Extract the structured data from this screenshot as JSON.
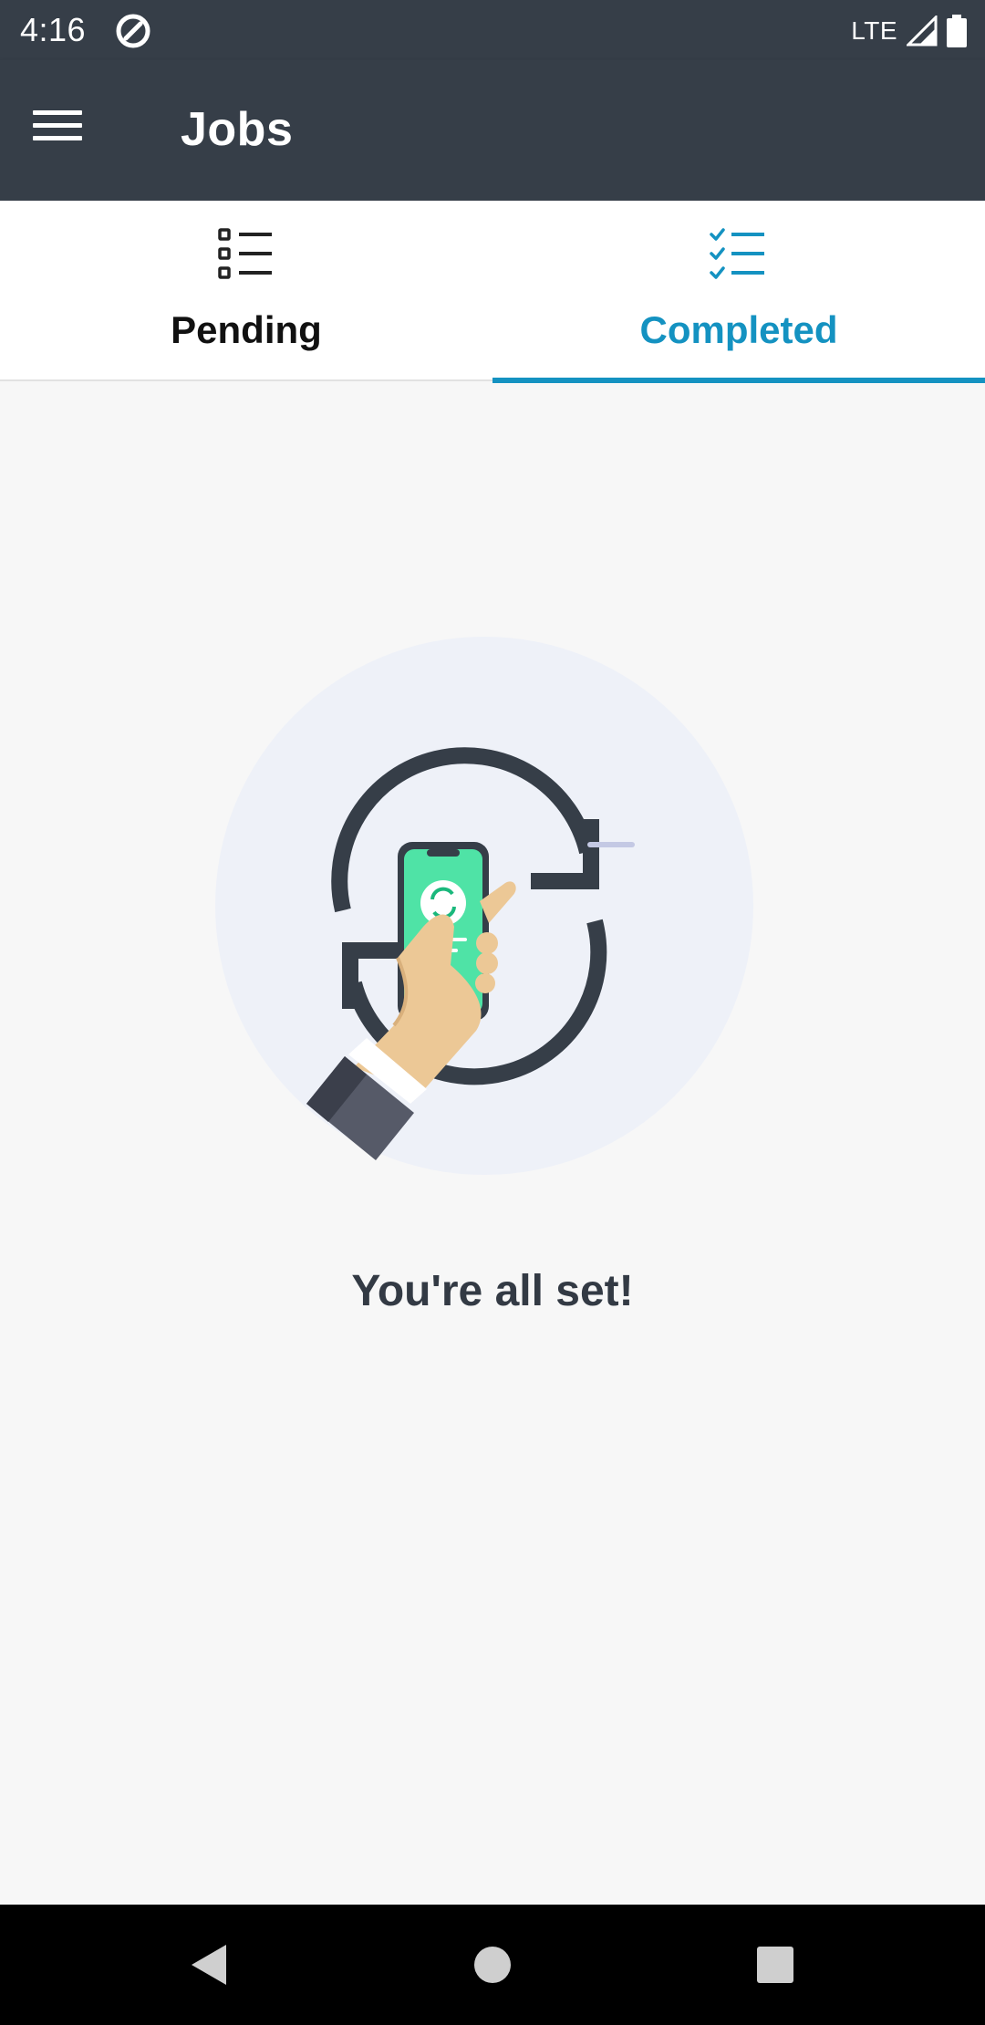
{
  "status_bar": {
    "time": "4:16",
    "network": "LTE",
    "icons": [
      "notification-icon",
      "signal-icon",
      "battery-icon"
    ]
  },
  "app_bar": {
    "title": "Jobs",
    "menu_icon": "hamburger-menu-icon"
  },
  "tabs": [
    {
      "label": "Pending",
      "icon": "list-icon",
      "selected": false
    },
    {
      "label": "Completed",
      "icon": "checklist-icon",
      "selected": true
    }
  ],
  "empty_state": {
    "illustration": "phone-sync-illustration",
    "message": "You're all set!"
  },
  "nav_bar": {
    "icons": [
      "back-icon",
      "home-icon",
      "recents-icon"
    ]
  },
  "colors": {
    "app_bar": "#363e48",
    "accent": "#1492c1",
    "background": "#f7f7f7",
    "illustration_circle": "#eef1f8",
    "phone_screen": "#4fe3a6"
  }
}
